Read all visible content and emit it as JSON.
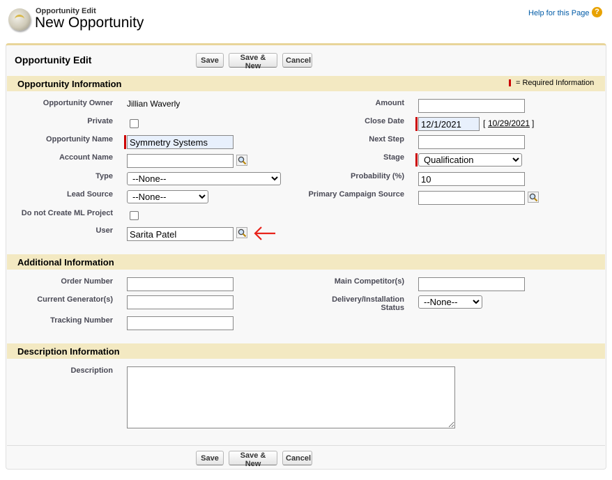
{
  "header": {
    "breadcrumb": "Opportunity Edit",
    "title": "New Opportunity",
    "help_link": "Help for this Page",
    "help_icon": "?"
  },
  "edit_block": {
    "title": "Opportunity Edit",
    "save_label": "Save",
    "save_new_label": "Save & New",
    "cancel_label": "Cancel"
  },
  "opportunity_info": {
    "section_title": "Opportunity Information",
    "required_legend": "= Required Information",
    "owner": {
      "label": "Opportunity Owner",
      "value": "Jillian Waverly"
    },
    "private": {
      "label": "Private",
      "checked": false
    },
    "opportunity_name": {
      "label": "Opportunity Name",
      "value": "Symmetry Systems"
    },
    "account_name": {
      "label": "Account Name",
      "value": ""
    },
    "type": {
      "label": "Type",
      "value": "--None--"
    },
    "lead_source": {
      "label": "Lead Source",
      "value": "--None--"
    },
    "no_ml_project": {
      "label": "Do not Create ML Project",
      "checked": false
    },
    "user": {
      "label": "User",
      "value": "Sarita Patel"
    },
    "amount": {
      "label": "Amount",
      "value": ""
    },
    "close_date": {
      "label": "Close Date",
      "value": "12/1/2021",
      "today_link": "10/29/2021",
      "bracket_open": "[",
      "bracket_close": "]"
    },
    "next_step": {
      "label": "Next Step",
      "value": ""
    },
    "stage": {
      "label": "Stage",
      "value": "Qualification"
    },
    "probability": {
      "label": "Probability (%)",
      "value": "10"
    },
    "campaign_source": {
      "label": "Primary Campaign Source",
      "value": ""
    }
  },
  "additional_info": {
    "section_title": "Additional Information",
    "order_number": {
      "label": "Order Number",
      "value": ""
    },
    "current_generators": {
      "label": "Current Generator(s)",
      "value": ""
    },
    "tracking_number": {
      "label": "Tracking Number",
      "value": ""
    },
    "main_competitors": {
      "label": "Main Competitor(s)",
      "value": ""
    },
    "delivery_status": {
      "label_line1": "Delivery/Installation",
      "label_line2": "Status",
      "value": "--None--"
    }
  },
  "description_info": {
    "section_title": "Description Information",
    "description": {
      "label": "Description",
      "value": ""
    }
  },
  "colors": {
    "section_bar": "#f3e9c2",
    "required_marker": "#cc0000",
    "link": "#015ba7",
    "annotation_arrow": "#e8231b"
  }
}
